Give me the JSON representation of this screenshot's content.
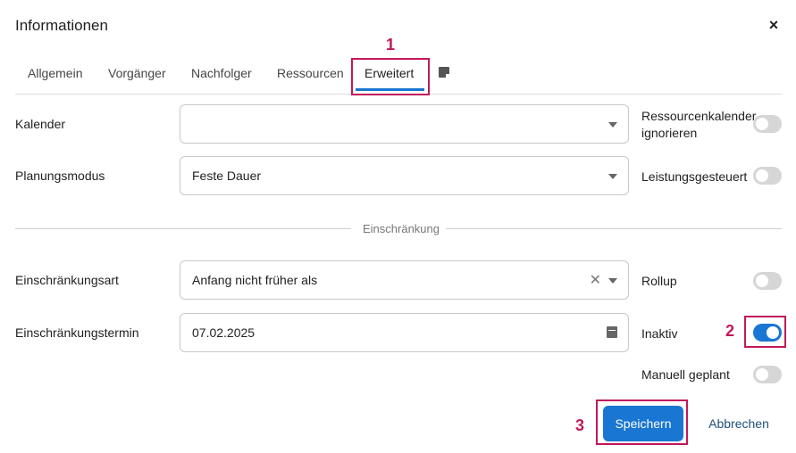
{
  "dialog": {
    "title": "Informationen",
    "close_label": "×"
  },
  "tabs": [
    {
      "label": "Allgemein"
    },
    {
      "label": "Vorgänger"
    },
    {
      "label": "Nachfolger"
    },
    {
      "label": "Ressourcen"
    },
    {
      "label": "Erweitert",
      "active": true
    }
  ],
  "fields": {
    "kalender": {
      "label": "Kalender",
      "value": ""
    },
    "planungsmodus": {
      "label": "Planungsmodus",
      "value": "Feste Dauer"
    },
    "einschraenkungsart": {
      "label": "Einschränkungsart",
      "value": "Anfang nicht früher als"
    },
    "einschraenkungstermin": {
      "label": "Einschränkungstermin",
      "value": "07.02.2025"
    }
  },
  "toggles": {
    "ressourcenkalender": {
      "label_line1": "Ressourcenkalender",
      "label_line2": "ignorieren",
      "on": false
    },
    "leistungsgesteuert": {
      "label": "Leistungsgesteuert",
      "on": false
    },
    "rollup": {
      "label": "Rollup",
      "on": false
    },
    "inaktiv": {
      "label": "Inaktiv",
      "on": true
    },
    "manuell": {
      "label": "Manuell geplant",
      "on": false
    }
  },
  "section": {
    "divider_label": "Einschränkung"
  },
  "buttons": {
    "save": "Speichern",
    "cancel": "Abbrechen"
  },
  "callouts": [
    "1",
    "2",
    "3"
  ],
  "colors": {
    "accent": "#1976d2",
    "highlight": "#c2185b"
  },
  "icons": [
    "close-icon",
    "note-icon",
    "chevron-down-icon",
    "clear-icon",
    "calendar-icon"
  ]
}
